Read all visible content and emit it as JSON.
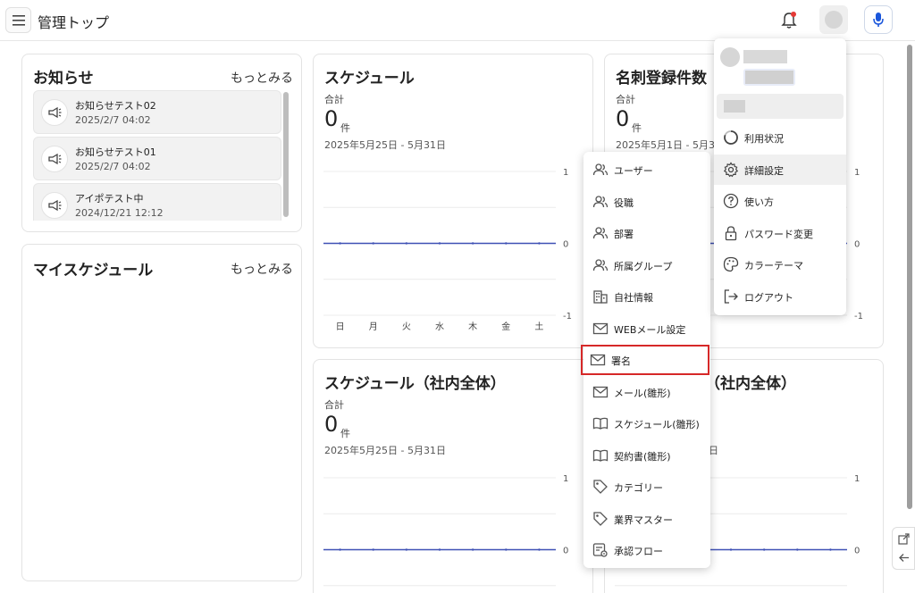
{
  "header": {
    "title": "管理トップ",
    "colors": {
      "bell_dot": "#e53935",
      "mic": "#1a56db"
    }
  },
  "news": {
    "title": "お知らせ",
    "more": "もっとみる",
    "items": [
      {
        "title": "お知らせテスト02",
        "date": "2025/2/7 04:02"
      },
      {
        "title": "お知らせテスト01",
        "date": "2025/2/7 04:02"
      },
      {
        "title": "アイポテスト中",
        "date": "2024/12/21 12:12"
      }
    ]
  },
  "my_schedule": {
    "title": "マイスケジュール",
    "more": "もっとみる"
  },
  "schedule": {
    "title": "スケジュール",
    "sum_label": "合計",
    "count": "0",
    "unit": "件",
    "range": "2025年5月25日 - 5月31日"
  },
  "cards": {
    "title": "名刺登録件数",
    "sum_label": "合計",
    "count": "0",
    "unit": "件",
    "range": "2025年5月1日 - 5月31日"
  },
  "schedule_all": {
    "title": "スケジュール（社内全体）",
    "sum_label": "合計",
    "count": "0",
    "unit": "件",
    "range": "2025年5月25日 - 5月31日"
  },
  "right_lower": {
    "title_fragment": "（社内全体）",
    "range_fragment": "日"
  },
  "chart_data": [
    {
      "type": "line",
      "categories": [
        "日",
        "月",
        "火",
        "水",
        "木",
        "金",
        "土"
      ],
      "series": [
        {
          "values": [
            0,
            0,
            0,
            0,
            0,
            0,
            0
          ]
        }
      ],
      "ylim": [
        -1,
        1
      ],
      "yticks": [
        "1",
        "0",
        "-1"
      ],
      "grid": true
    },
    {
      "type": "line",
      "series": [
        {
          "values": [
            0,
            0,
            0,
            0,
            0,
            0,
            0
          ]
        }
      ],
      "ylim": [
        -1,
        1
      ],
      "yticks": [
        "1",
        "0",
        "-1"
      ],
      "grid": true
    },
    {
      "type": "line",
      "series": [
        {
          "values": [
            0,
            0,
            0,
            0,
            0,
            0,
            0
          ]
        }
      ],
      "ylim": [
        -1,
        1
      ],
      "yticks": [
        "1",
        "0"
      ],
      "grid": true
    },
    {
      "type": "line",
      "series": [
        {
          "values": [
            0,
            0,
            0,
            0,
            0,
            0,
            0
          ]
        }
      ],
      "ylim": [
        -1,
        1
      ],
      "yticks": [
        "1",
        "0"
      ],
      "grid": true
    }
  ],
  "settings_menu": {
    "items": [
      {
        "label": "ユーザー",
        "icon": "users-icon"
      },
      {
        "label": "役職",
        "icon": "users-icon"
      },
      {
        "label": "部署",
        "icon": "users-icon"
      },
      {
        "label": "所属グループ",
        "icon": "users-icon"
      },
      {
        "label": "自社情報",
        "icon": "building-icon"
      },
      {
        "label": "WEBメール設定",
        "icon": "mail-icon"
      },
      {
        "label": "署名",
        "icon": "mail-icon"
      },
      {
        "label": "メール(雛形)",
        "icon": "mail-icon"
      },
      {
        "label": "スケジュール(雛形)",
        "icon": "book-icon"
      },
      {
        "label": "契約書(雛形)",
        "icon": "book-icon"
      },
      {
        "label": "カテゴリー",
        "icon": "tag-icon"
      },
      {
        "label": "業界マスター",
        "icon": "tag-icon"
      },
      {
        "label": "承認フロー",
        "icon": "workflow-icon"
      }
    ],
    "highlighted": "署名"
  },
  "user_menu": {
    "items": [
      {
        "label": "利用状況",
        "icon": "usage-icon"
      },
      {
        "label": "詳細設定",
        "icon": "gear-icon"
      },
      {
        "label": "使い方",
        "icon": "help-icon"
      },
      {
        "label": "パスワード変更",
        "icon": "lock-icon"
      },
      {
        "label": "カラーテーマ",
        "icon": "palette-icon"
      },
      {
        "label": "ログアウト",
        "icon": "logout-icon"
      }
    ],
    "selected": "詳細設定"
  }
}
